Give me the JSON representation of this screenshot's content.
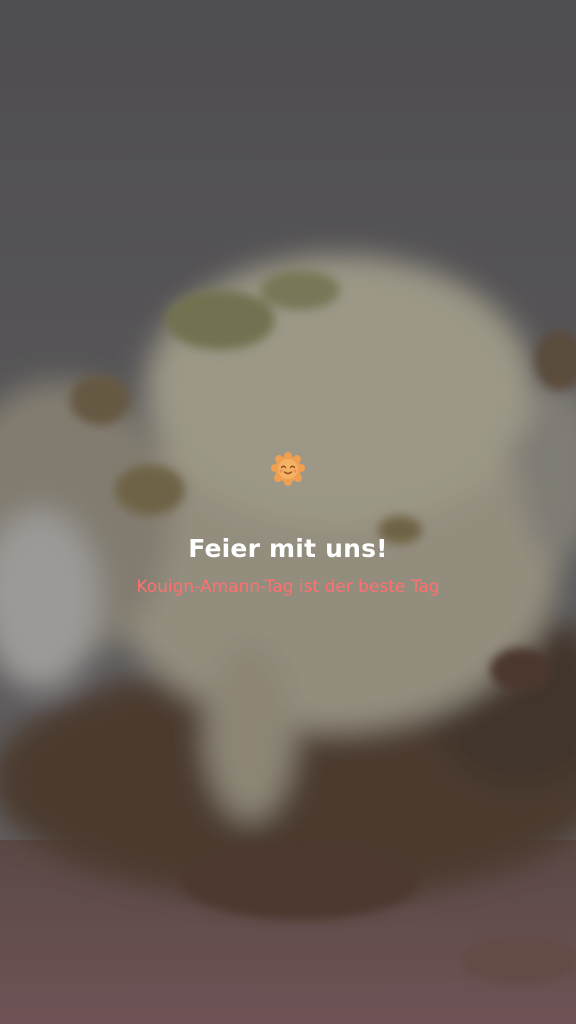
{
  "story": {
    "title": "Feier mit uns!",
    "subtitle": "Kouign-Amann-Tag ist der beste Tag",
    "badge_icon": "smiling-pastry-icon"
  },
  "colors": {
    "title": "#ffffff",
    "subtitle": "#ff7070",
    "badge": "#f0a050"
  }
}
